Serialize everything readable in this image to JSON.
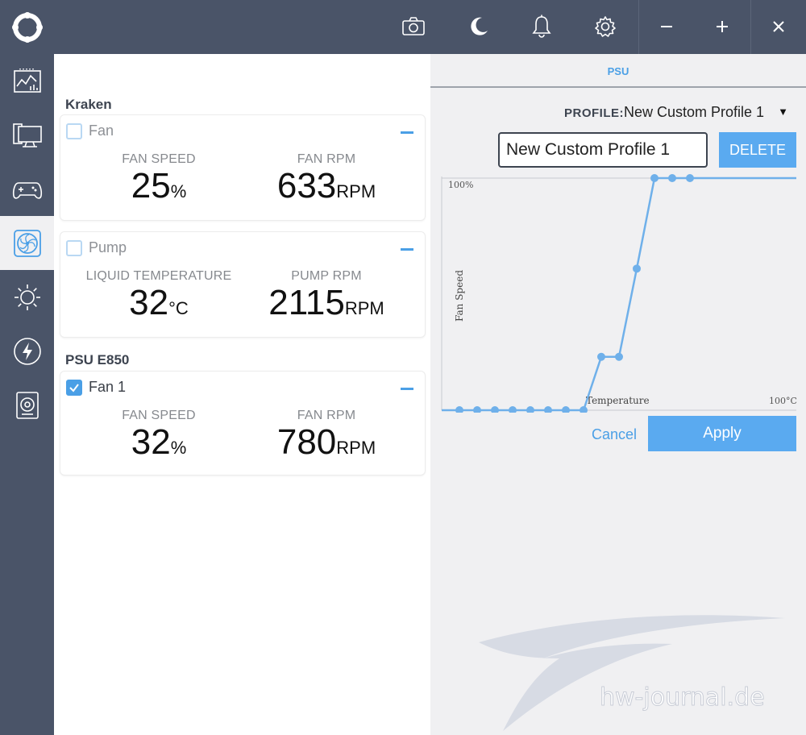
{
  "topbar": {
    "icons": [
      "camera-icon",
      "moon-icon",
      "bell-icon",
      "gear-icon",
      "minimize-icon",
      "maximize-icon",
      "close-icon"
    ]
  },
  "sidebar": {
    "items": [
      {
        "name": "monitoring-icon"
      },
      {
        "name": "pc-icon"
      },
      {
        "name": "gamepad-icon"
      },
      {
        "name": "fan-icon",
        "active": true
      },
      {
        "name": "lighting-icon"
      },
      {
        "name": "power-icon"
      },
      {
        "name": "audio-icon"
      }
    ]
  },
  "groups": [
    {
      "title": "Kraken",
      "cards": [
        {
          "name": "Fan",
          "checked": false,
          "metrics": [
            {
              "label": "FAN SPEED",
              "value": "25",
              "unit": "%"
            },
            {
              "label": "FAN RPM",
              "value": "633",
              "unit": "RPM"
            }
          ]
        },
        {
          "name": "Pump",
          "checked": false,
          "metrics": [
            {
              "label": "LIQUID TEMPERATURE",
              "value": "32",
              "unit": "°C"
            },
            {
              "label": "PUMP RPM",
              "value": "2115",
              "unit": "RPM"
            }
          ]
        }
      ]
    },
    {
      "title": "PSU E850",
      "cards": [
        {
          "name": "Fan 1",
          "checked": true,
          "metrics": [
            {
              "label": "FAN SPEED",
              "value": "32",
              "unit": "%"
            },
            {
              "label": "FAN RPM",
              "value": "780",
              "unit": "RPM"
            }
          ]
        }
      ]
    }
  ],
  "right": {
    "tab": "PSU",
    "profile_label": "PROFILE:",
    "profile_value": "New Custom Profile 1",
    "caret": "▼",
    "name_input_value": "New Custom Profile 1",
    "delete_label": "DELETE",
    "cancel_label": "Cancel",
    "apply_label": "Apply"
  },
  "chart_data": {
    "type": "line",
    "xlabel": "Temperature",
    "ylabel": "Fan Speed",
    "x_max_label": "100°C",
    "y_max_label": "100%",
    "xlim": [
      0,
      100
    ],
    "ylim": [
      0,
      100
    ],
    "x": [
      5,
      10,
      15,
      20,
      25,
      30,
      35,
      40,
      45,
      50,
      55,
      60,
      65,
      70
    ],
    "y": [
      0,
      0,
      0,
      0,
      0,
      0,
      0,
      0,
      23,
      23,
      61,
      100,
      100,
      100
    ],
    "color": "#6fb0ea"
  },
  "watermark": {
    "text": "hw-journal.de"
  },
  "colors": {
    "accent": "#5aaaf0",
    "dark": "#4a5468"
  }
}
